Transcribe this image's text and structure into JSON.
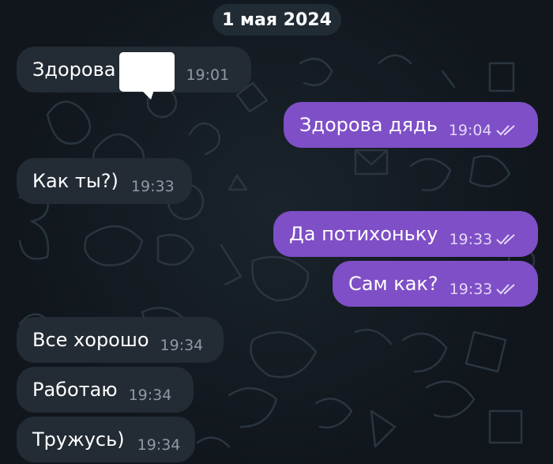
{
  "date_divider": "1 мая 2024",
  "messages": [
    {
      "text": "Здорова",
      "time": "19:01"
    },
    {
      "text": "Здорова дядь",
      "time": "19:04"
    },
    {
      "text": "Как ты?)",
      "time": "19:33"
    },
    {
      "text": "Да потихоньку",
      "time": "19:33"
    },
    {
      "text": "Сам как?",
      "time": "19:33"
    },
    {
      "text": "Все хорошо",
      "time": "19:34"
    },
    {
      "text": "Работаю",
      "time": "19:34"
    },
    {
      "text": "Тружусь)",
      "time": "19:34"
    }
  ],
  "colors": {
    "incoming_bubble": "#232b34",
    "outgoing_bubble": "#7e4fc6",
    "background": "#10161c"
  }
}
